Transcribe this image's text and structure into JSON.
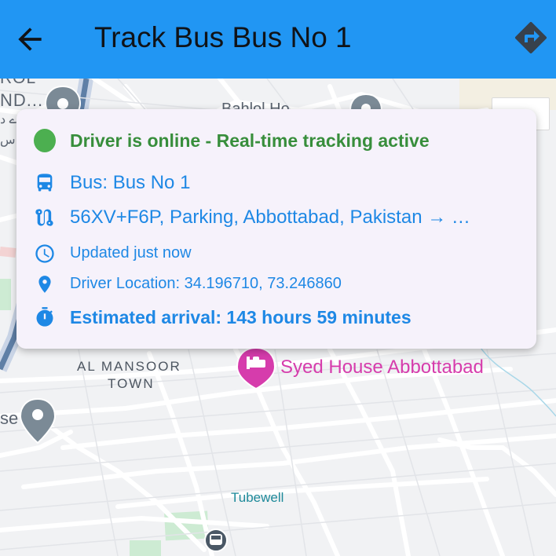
{
  "appbar": {
    "title": "Track Bus Bus No 1",
    "back_icon": "arrow-back-icon",
    "directions_icon": "directions-icon",
    "color": "#2196f3"
  },
  "status_card": {
    "status_text": "Driver is online - Real-time tracking active",
    "status_color": "#388e3c",
    "online_indicator_color": "#4caf50",
    "bus_label": "Bus: Bus No 1",
    "route_text": "56XV+F6P, Parking, Abbottabad, Pakistan → …",
    "updated_text": "Updated just now",
    "driver_location": "Driver Location: 34.196710, 73.246860",
    "eta_text": "Estimated arrival: 143 hours 59 minutes",
    "accent_color": "#1e88e5",
    "icons": [
      "bus-icon",
      "route-icon",
      "clock-icon",
      "location-pin-icon",
      "timer-icon"
    ]
  },
  "map": {
    "labels": {
      "top_left_partial": "ROL",
      "top_left_partial2": "ND...",
      "top_left_partial3": "ے د",
      "top_left_partial4": "س",
      "top_partial": "Bahlol Ho",
      "neighbourhood_line1": "AL MANSOOR",
      "neighbourhood_line2": "TOWN",
      "hotel": "Syed House Abbottabad",
      "tubewell": "Tubewell",
      "left_partial": "se"
    },
    "hotel_color": "#d63cac",
    "pin_color": "#7b8a96",
    "water_label_color": "#1e8a9a"
  }
}
